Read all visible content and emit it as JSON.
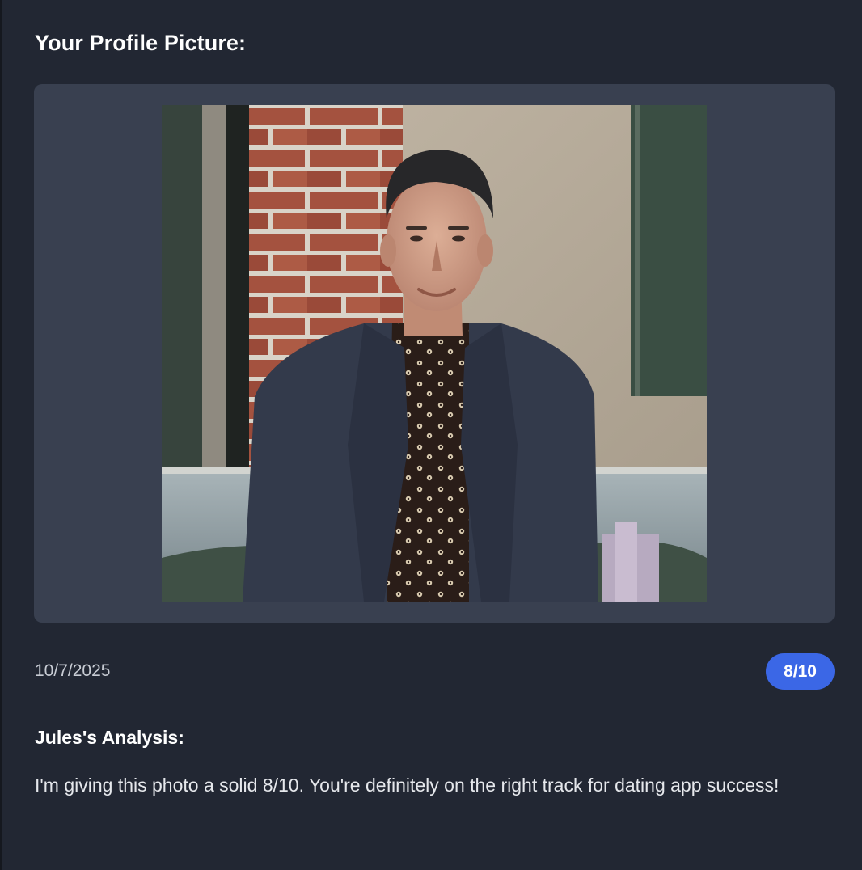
{
  "profile": {
    "title": "Your Profile Picture:",
    "photo_alt": "Profile photo of a smiling man in a dark blazer and patterned shirt in front of a brick wall"
  },
  "meta": {
    "date": "10/7/2025",
    "score": "8/10"
  },
  "analysis": {
    "title": "Jules's Analysis:",
    "text": "I'm giving this photo a solid 8/10. You're definitely on the right track for dating app success!"
  },
  "colors": {
    "background": "#222733",
    "card": "#394050",
    "badge": "#3b67e6"
  }
}
